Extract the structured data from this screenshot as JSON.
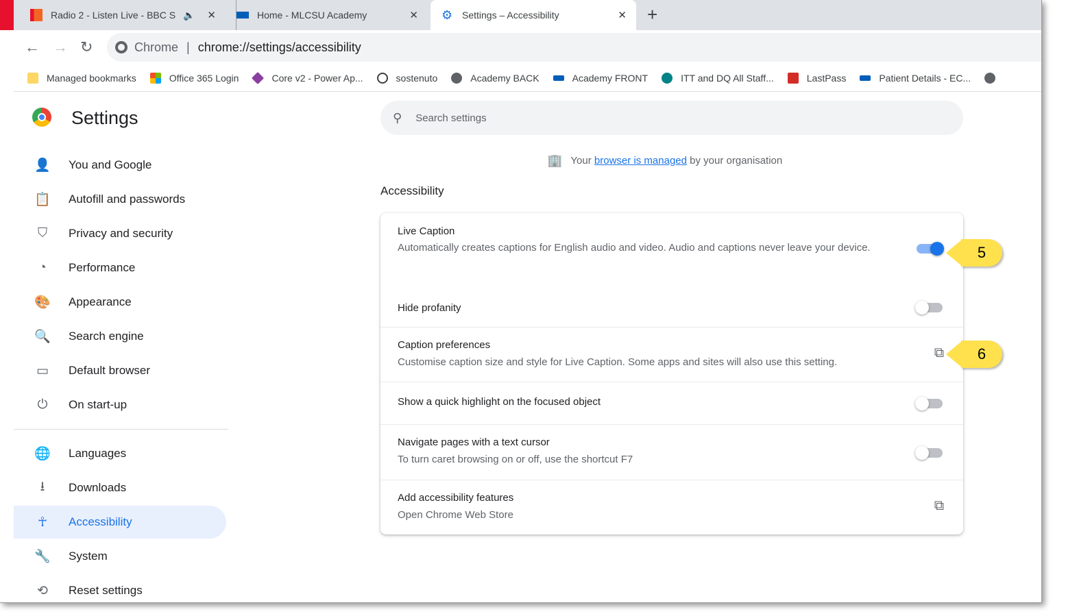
{
  "tabs": [
    {
      "title": "Radio 2 - Listen Live - BBC S",
      "icon": "bbc-radio-icon"
    },
    {
      "title": "Home - MLCSU Academy",
      "icon": "nhs-icon"
    },
    {
      "title": "Settings – Accessibility",
      "icon": "settings-gear-icon",
      "active": true
    }
  ],
  "omnibox": {
    "site": "Chrome",
    "url": "chrome://settings/accessibility"
  },
  "bookmarks": [
    "Managed bookmarks",
    "Office 365 Login",
    "Core v2 - Power Ap...",
    "sostenuto",
    "Academy BACK",
    "Academy FRONT",
    "ITT and DQ All Staff...",
    "LastPass",
    "Patient Details - EC..."
  ],
  "settings": {
    "title": "Settings",
    "search_placeholder": "Search settings",
    "sidebar": [
      "You and Google",
      "Autofill and passwords",
      "Privacy and security",
      "Performance",
      "Appearance",
      "Search engine",
      "Default browser",
      "On start-up",
      "Languages",
      "Downloads",
      "Accessibility",
      "System",
      "Reset settings"
    ],
    "managed": {
      "pre": "Your",
      "link": "browser is managed",
      "post": "by your organisation"
    },
    "section": "Accessibility",
    "rows": [
      {
        "title": "Live Caption",
        "desc": "Automatically creates captions for English audio and video. Audio and captions never leave your device.",
        "toggle": true
      },
      {
        "title": "Hide profanity",
        "toggle": false
      },
      {
        "title": "Caption preferences",
        "desc": "Customise caption size and style for Live Caption. Some apps and sites will also use this setting.",
        "external": true
      },
      {
        "title": "Show a quick highlight on the focused object",
        "toggle": false
      },
      {
        "title": "Navigate pages with a text cursor",
        "desc": "To turn caret browsing on or off, use the shortcut F7",
        "toggle": false
      },
      {
        "title": "Add accessibility features",
        "desc": "Open Chrome Web Store",
        "external": true
      }
    ]
  },
  "callouts": [
    "5",
    "6"
  ],
  "colors": {
    "accent": "#1a73e8",
    "callout": "#ffe14d",
    "selected_bg": "#e8f0fe"
  }
}
